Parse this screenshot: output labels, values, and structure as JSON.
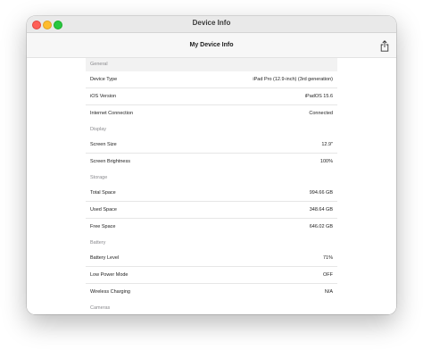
{
  "window": {
    "title": "Device Info"
  },
  "navbar": {
    "title": "My Device Info",
    "share_icon": "share-icon"
  },
  "sections": [
    {
      "header": "General",
      "rows": [
        {
          "label": "Device Type",
          "value": "iPad Pro (12.9-inch) (3rd generation)"
        },
        {
          "label": "iOS Version",
          "value": "iPadOS 15.6"
        },
        {
          "label": "Internet Connection",
          "value": "Connected"
        }
      ]
    },
    {
      "header": "Display",
      "rows": [
        {
          "label": "Screen Size",
          "value": "12.9\""
        },
        {
          "label": "Screen Brightness",
          "value": "100%"
        }
      ]
    },
    {
      "header": "Storage",
      "rows": [
        {
          "label": "Total Space",
          "value": "994.66 GB"
        },
        {
          "label": "Used Space",
          "value": "348.64 GB"
        },
        {
          "label": "Free Space",
          "value": "646.02 GB"
        }
      ]
    },
    {
      "header": "Battery",
      "rows": [
        {
          "label": "Battery Level",
          "value": "71%"
        },
        {
          "label": "Low Power Mode",
          "value": "OFF"
        },
        {
          "label": "Wireless Charging",
          "value": "N/A"
        }
      ]
    },
    {
      "header": "Cameras",
      "rows": []
    }
  ]
}
